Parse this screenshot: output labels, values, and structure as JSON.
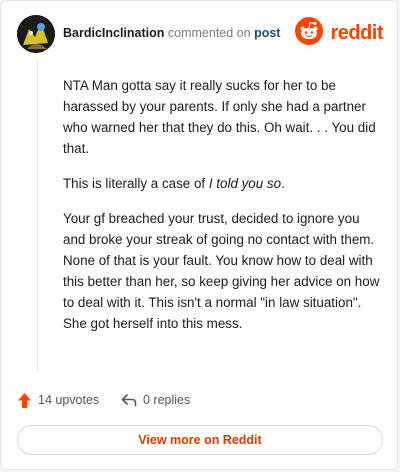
{
  "header": {
    "username": "BardicInclination",
    "action_text": "commented on",
    "post_link": "post",
    "brand": "reddit"
  },
  "comment": {
    "p1": "NTA Man gotta say it really sucks for her to be harassed by your parents. If only she had a partner who warned her that they do this. Oh wait. . . You did that.",
    "p2_prefix": "This is literally a case of ",
    "p2_emphasis": "I told you so",
    "p2_suffix": ".",
    "p3": "Your gf breached your trust, decided to ignore you and broke your streak of going no contact with them. None of that is your fault. You know how to deal with this better than her, so keep giving her advice on how to deal with it. This isn't a normal \"in law situation\". She got herself into this mess."
  },
  "actions": {
    "upvotes": "14 upvotes",
    "replies": "0 replies"
  },
  "footer": {
    "more_label": "View more on Reddit"
  },
  "colors": {
    "accent": "#ff4500",
    "link": "#1c4e80",
    "more": "#d93a00"
  }
}
